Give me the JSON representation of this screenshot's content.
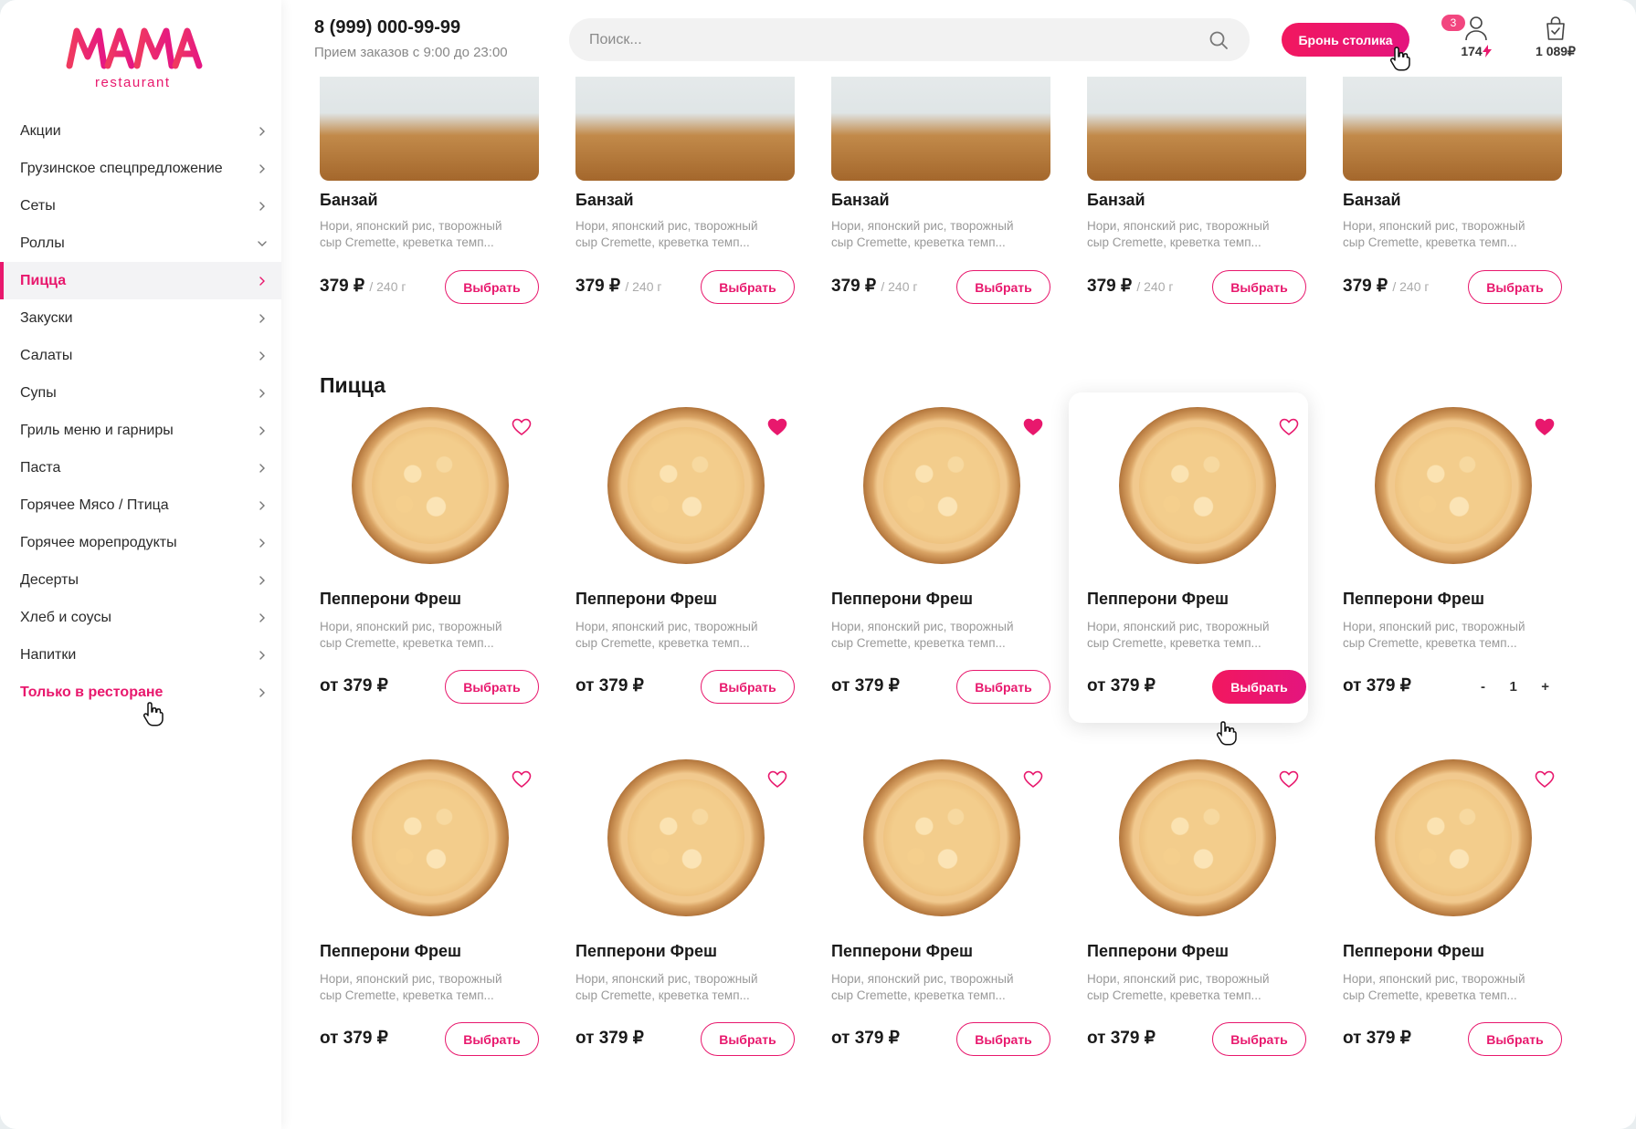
{
  "brand": {
    "logo_text": "MAMA",
    "logo_sub": "restaurant",
    "accent": "#e8186d"
  },
  "sidebar": {
    "items": [
      {
        "label": "Акции",
        "state": "normal"
      },
      {
        "label": "Грузинское спецпредложение",
        "state": "normal"
      },
      {
        "label": "Сеты",
        "state": "normal"
      },
      {
        "label": "Роллы",
        "state": "expanded"
      },
      {
        "label": "Пицца",
        "state": "active"
      },
      {
        "label": "Закуски",
        "state": "normal"
      },
      {
        "label": "Салаты",
        "state": "normal"
      },
      {
        "label": "Супы",
        "state": "normal"
      },
      {
        "label": "Гриль меню и гарниры",
        "state": "normal"
      },
      {
        "label": "Паста",
        "state": "normal"
      },
      {
        "label": "Горячее Мясо / Птица",
        "state": "normal"
      },
      {
        "label": "Горячее морепродукты",
        "state": "normal"
      },
      {
        "label": "Десерты",
        "state": "normal"
      },
      {
        "label": "Хлеб и соусы",
        "state": "normal"
      },
      {
        "label": "Напитки",
        "state": "normal"
      },
      {
        "label": "Только в ресторане",
        "state": "highlight"
      }
    ]
  },
  "header": {
    "phone": "8 (999) 000-99-99",
    "hours": "Прием заказов с 9:00 до 23:00",
    "search_placeholder": "Поиск...",
    "book_label": "Бронь столика",
    "bonus": "174",
    "cart_total": "1 089₽",
    "cart_count": "3"
  },
  "rolls": {
    "items": [
      {
        "title": "Банзай",
        "desc1": "Нори, японский рис, творожный",
        "desc2": "сыр Cremette, креветка темп...",
        "price": "379 ₽",
        "weight": "/ 240 г",
        "button": "Выбрать"
      },
      {
        "title": "Банзай",
        "desc1": "Нори, японский рис, творожный",
        "desc2": "сыр Cremette, креветка темп...",
        "price": "379 ₽",
        "weight": "/ 240 г",
        "button": "Выбрать"
      },
      {
        "title": "Банзай",
        "desc1": "Нори, японский рис, творожный",
        "desc2": "сыр Cremette, креветка темп...",
        "price": "379 ₽",
        "weight": "/ 240 г",
        "button": "Выбрать"
      },
      {
        "title": "Банзай",
        "desc1": "Нори, японский рис, творожный",
        "desc2": "сыр Cremette, креветка темп...",
        "price": "379 ₽",
        "weight": "/ 240 г",
        "button": "Выбрать"
      },
      {
        "title": "Банзай",
        "desc1": "Нори, японский рис, творожный",
        "desc2": "сыр Cremette, креветка темп...",
        "price": "379 ₽",
        "weight": "/ 240 г",
        "button": "Выбрать"
      }
    ]
  },
  "pizza": {
    "section_title": "Пицца",
    "rows": [
      [
        {
          "title": "Пепперони Фреш",
          "desc1": "Нори, японский рис, творожный",
          "desc2": "сыр Cremette, креветка темп...",
          "price": "от 379 ₽",
          "button": "Выбрать",
          "favorite": false
        },
        {
          "title": "Пепперони Фреш",
          "desc1": "Нори, японский рис, творожный",
          "desc2": "сыр Cremette, креветка темп...",
          "price": "от 379 ₽",
          "button": "Выбрать",
          "favorite": true
        },
        {
          "title": "Пепперони Фреш",
          "desc1": "Нори, японский рис, творожный",
          "desc2": "сыр Cremette, креветка темп...",
          "price": "от 379 ₽",
          "button": "Выбрать",
          "favorite": true
        },
        {
          "title": "Пепперони Фреш",
          "desc1": "Нори, японский рис, творожный",
          "desc2": "сыр Cremette, креветка темп...",
          "price": "от 379 ₽",
          "button": "Выбрать",
          "favorite": false,
          "hover": true
        },
        {
          "title": "Пепперони Фреш",
          "desc1": "Нори, японский рис, творожный",
          "desc2": "сыр Cremette, креветка темп...",
          "price": "от 379 ₽",
          "favorite": true,
          "stepper": {
            "minus": "-",
            "qty": "1",
            "plus": "+"
          }
        }
      ],
      [
        {
          "title": "Пепперони Фреш",
          "desc1": "Нори, японский рис, творожный",
          "desc2": "сыр Cremette, креветка темп...",
          "price": "от 379 ₽",
          "button": "Выбрать",
          "favorite": false
        },
        {
          "title": "Пепперони Фреш",
          "desc1": "Нори, японский рис, творожный",
          "desc2": "сыр Cremette, креветка темп...",
          "price": "от 379 ₽",
          "button": "Выбрать",
          "favorite": false
        },
        {
          "title": "Пепперони Фреш",
          "desc1": "Нори, японский рис, творожный",
          "desc2": "сыр Cremette, креветка темп...",
          "price": "от 379 ₽",
          "button": "Выбрать",
          "favorite": false
        },
        {
          "title": "Пепперони Фреш",
          "desc1": "Нори, японский рис, творожный",
          "desc2": "сыр Cremette, креветка темп...",
          "price": "от 379 ₽",
          "button": "Выбрать",
          "favorite": false
        },
        {
          "title": "Пепперони Фреш",
          "desc1": "Нори, японский рис, творожный",
          "desc2": "сыр Cremette, креветка темп...",
          "price": "от 379 ₽",
          "button": "Выбрать",
          "favorite": false
        }
      ]
    ]
  }
}
